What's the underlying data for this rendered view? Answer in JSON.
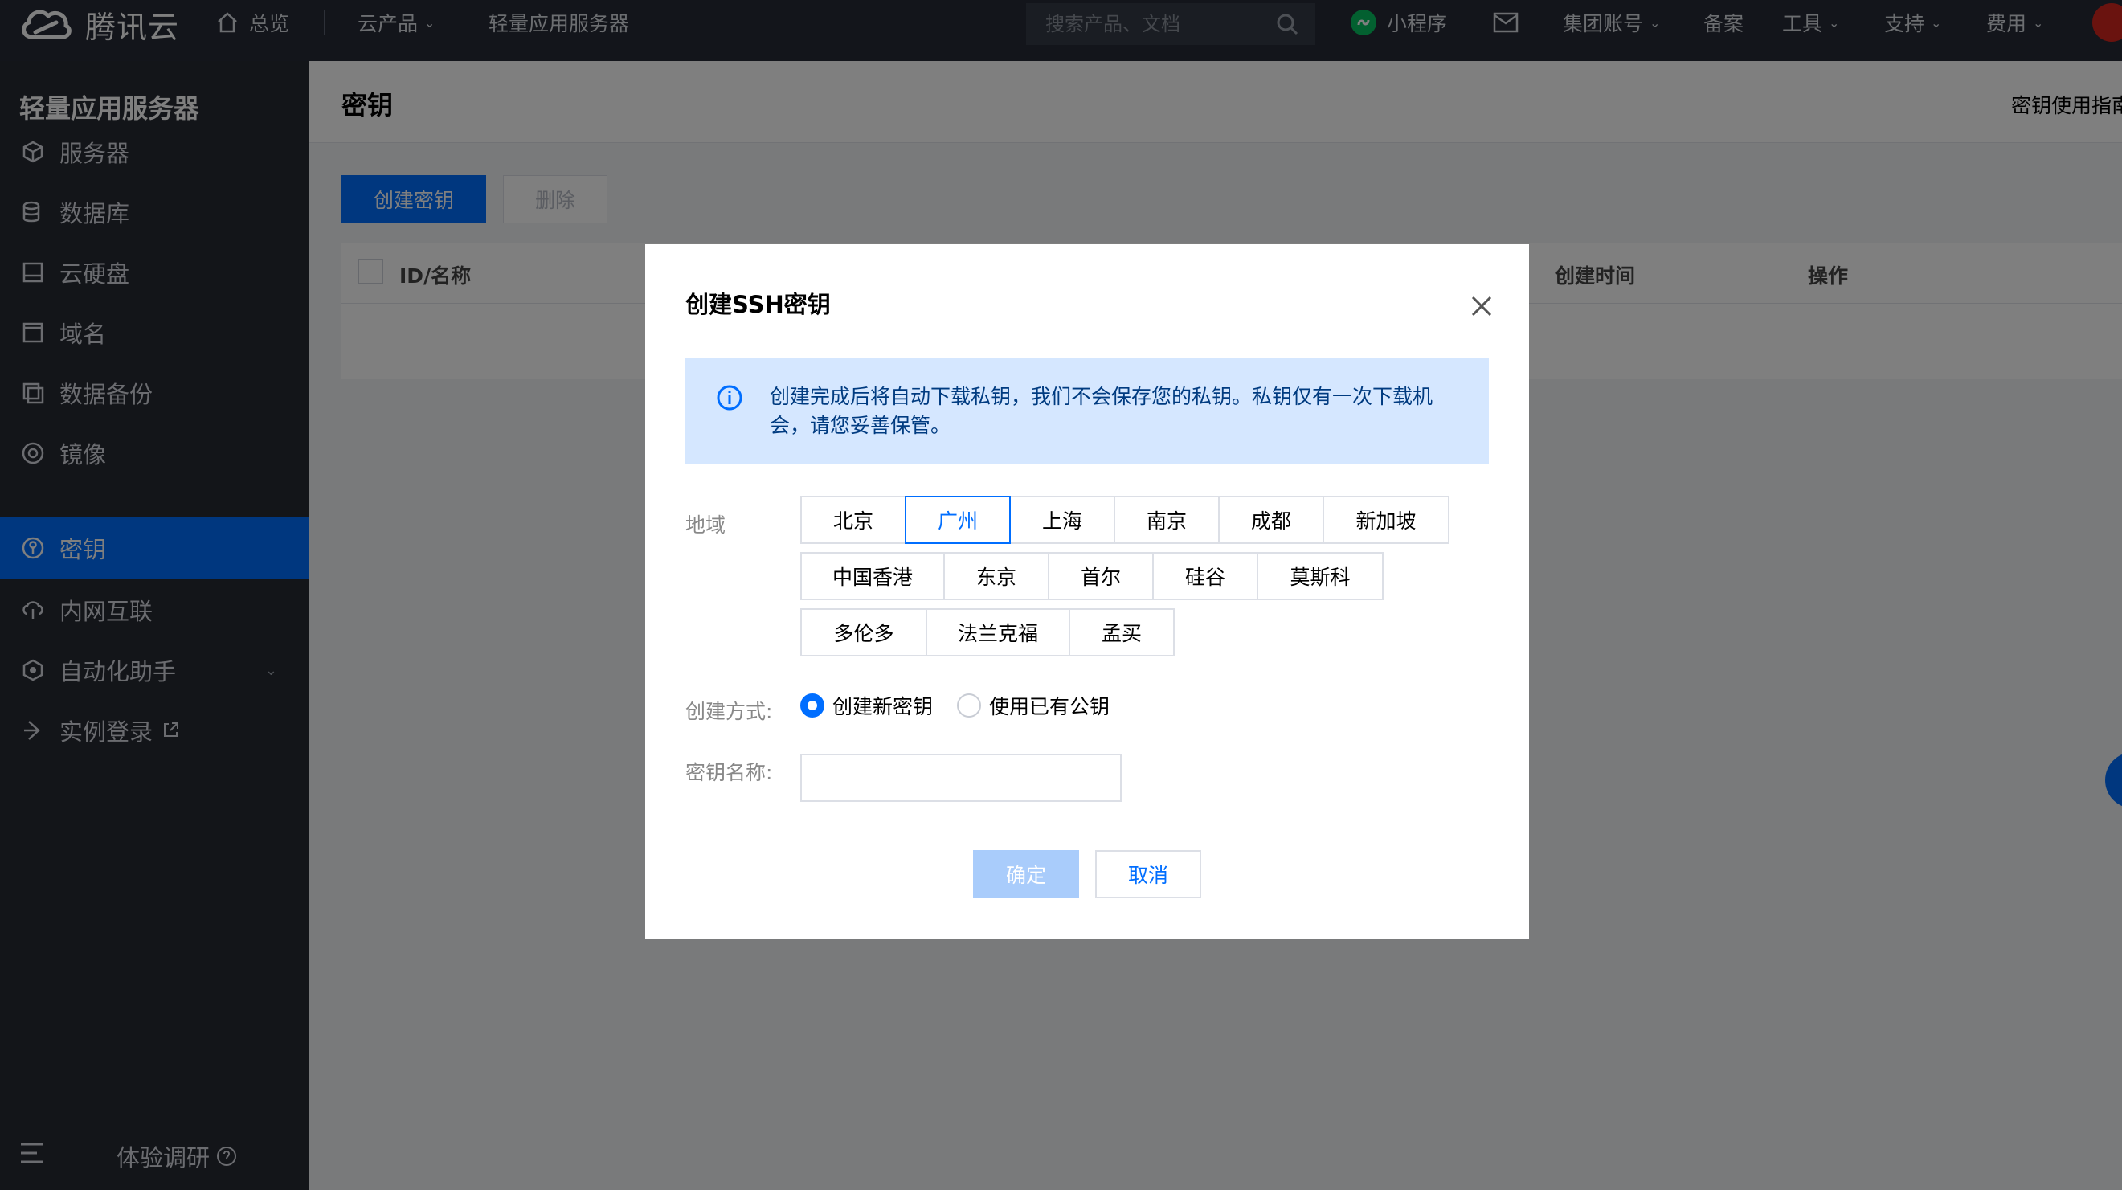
{
  "topbar": {
    "logo_text": "腾讯云",
    "overview": "总览",
    "products": "云产品",
    "breadcrumb_product": "轻量应用服务器",
    "search_placeholder": "搜索产品、文档",
    "mini_program": "小程序",
    "group_account": "集团账号",
    "filing": "备案",
    "tools": "工具",
    "support": "支持",
    "billing": "费用"
  },
  "sidebar": {
    "title": "轻量应用服务器",
    "items": [
      {
        "label": "服务器",
        "icon": "cube-icon"
      },
      {
        "label": "数据库",
        "icon": "database-icon"
      },
      {
        "label": "云硬盘",
        "icon": "disk-icon"
      },
      {
        "label": "域名",
        "icon": "domain-icon"
      },
      {
        "label": "数据备份",
        "icon": "backup-icon"
      },
      {
        "label": "镜像",
        "icon": "image-icon"
      },
      {
        "label": "密钥",
        "icon": "key-icon"
      },
      {
        "label": "内网互联",
        "icon": "network-icon"
      },
      {
        "label": "自动化助手",
        "icon": "automation-icon"
      },
      {
        "label": "实例登录",
        "icon": "login-icon"
      }
    ],
    "active_index": 6,
    "survey": "体验调研"
  },
  "main": {
    "page_title": "密钥",
    "guide_link": "密钥使用指南",
    "create_button": "创建密钥",
    "delete_button": "删除",
    "table_headers": {
      "id_name": "ID/名称",
      "created_time": "创建时间",
      "actions": "操作"
    }
  },
  "dialog": {
    "title": "创建SSH密钥",
    "notice_line1": "创建完成后将自动下载私钥，我们不会保存您的私钥。私钥仅有一次下载机",
    "notice_line2": "会，请您妥善保管。",
    "region_label": "地域",
    "regions": [
      "北京",
      "广州",
      "上海",
      "南京",
      "成都",
      "新加坡",
      "中国香港",
      "东京",
      "首尔",
      "硅谷",
      "莫斯科",
      "多伦多",
      "法兰克福",
      "孟买"
    ],
    "selected_region": "广州",
    "method_label": "创建方式:",
    "method_new": "创建新密钥",
    "method_existing": "使用已有公钥",
    "selected_method": "创建新密钥",
    "name_label": "密钥名称:",
    "name_value": "",
    "ok_button": "确定",
    "cancel_button": "取消"
  },
  "colors": {
    "brand_blue": "#006eff",
    "topbar_bg": "#262b36",
    "sidebar_bg": "#262a33",
    "notice_bg": "#d5e7ff",
    "ok_disabled": "#a9ccfb"
  }
}
